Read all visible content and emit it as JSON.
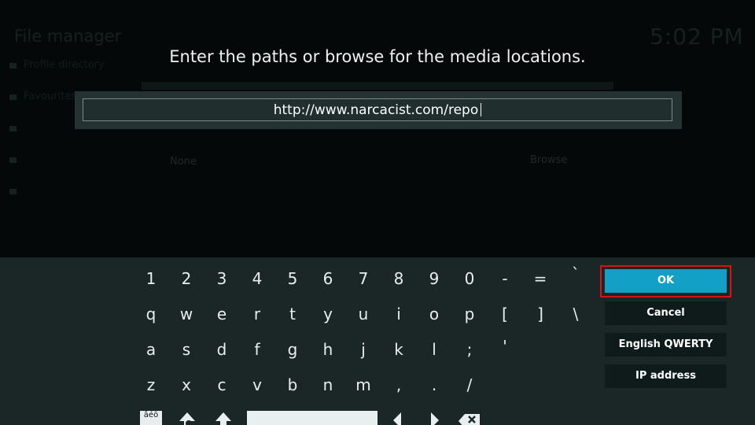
{
  "background": {
    "title": "File manager",
    "clock": "5:02 PM",
    "list_items": [
      "Profile directory",
      "Favourites",
      "",
      "",
      ""
    ],
    "none_label": "None",
    "browse_label": "Browse"
  },
  "dialog": {
    "heading": "Enter the paths or browse for the media locations.",
    "input_value": "http://www.narcacist.com/repo"
  },
  "keyboard": {
    "row1": [
      "1",
      "2",
      "3",
      "4",
      "5",
      "6",
      "7",
      "8",
      "9",
      "0",
      "-",
      "=",
      "`"
    ],
    "row2": [
      "q",
      "w",
      "e",
      "r",
      "t",
      "y",
      "u",
      "i",
      "o",
      "p",
      "[",
      "]",
      "\\"
    ],
    "row3": [
      "a",
      "s",
      "d",
      "f",
      "g",
      "h",
      "j",
      "k",
      "l",
      ";",
      "'"
    ],
    "row4": [
      "z",
      "x",
      "c",
      "v",
      "b",
      "n",
      "m",
      ",",
      ".",
      "/"
    ],
    "accent_key": "âéö",
    "buttons": {
      "ok": "OK",
      "cancel": "Cancel",
      "layout": "English QWERTY",
      "ip": "IP address"
    },
    "highlight_color": "#d41414",
    "accent_color": "#12a0c6"
  }
}
